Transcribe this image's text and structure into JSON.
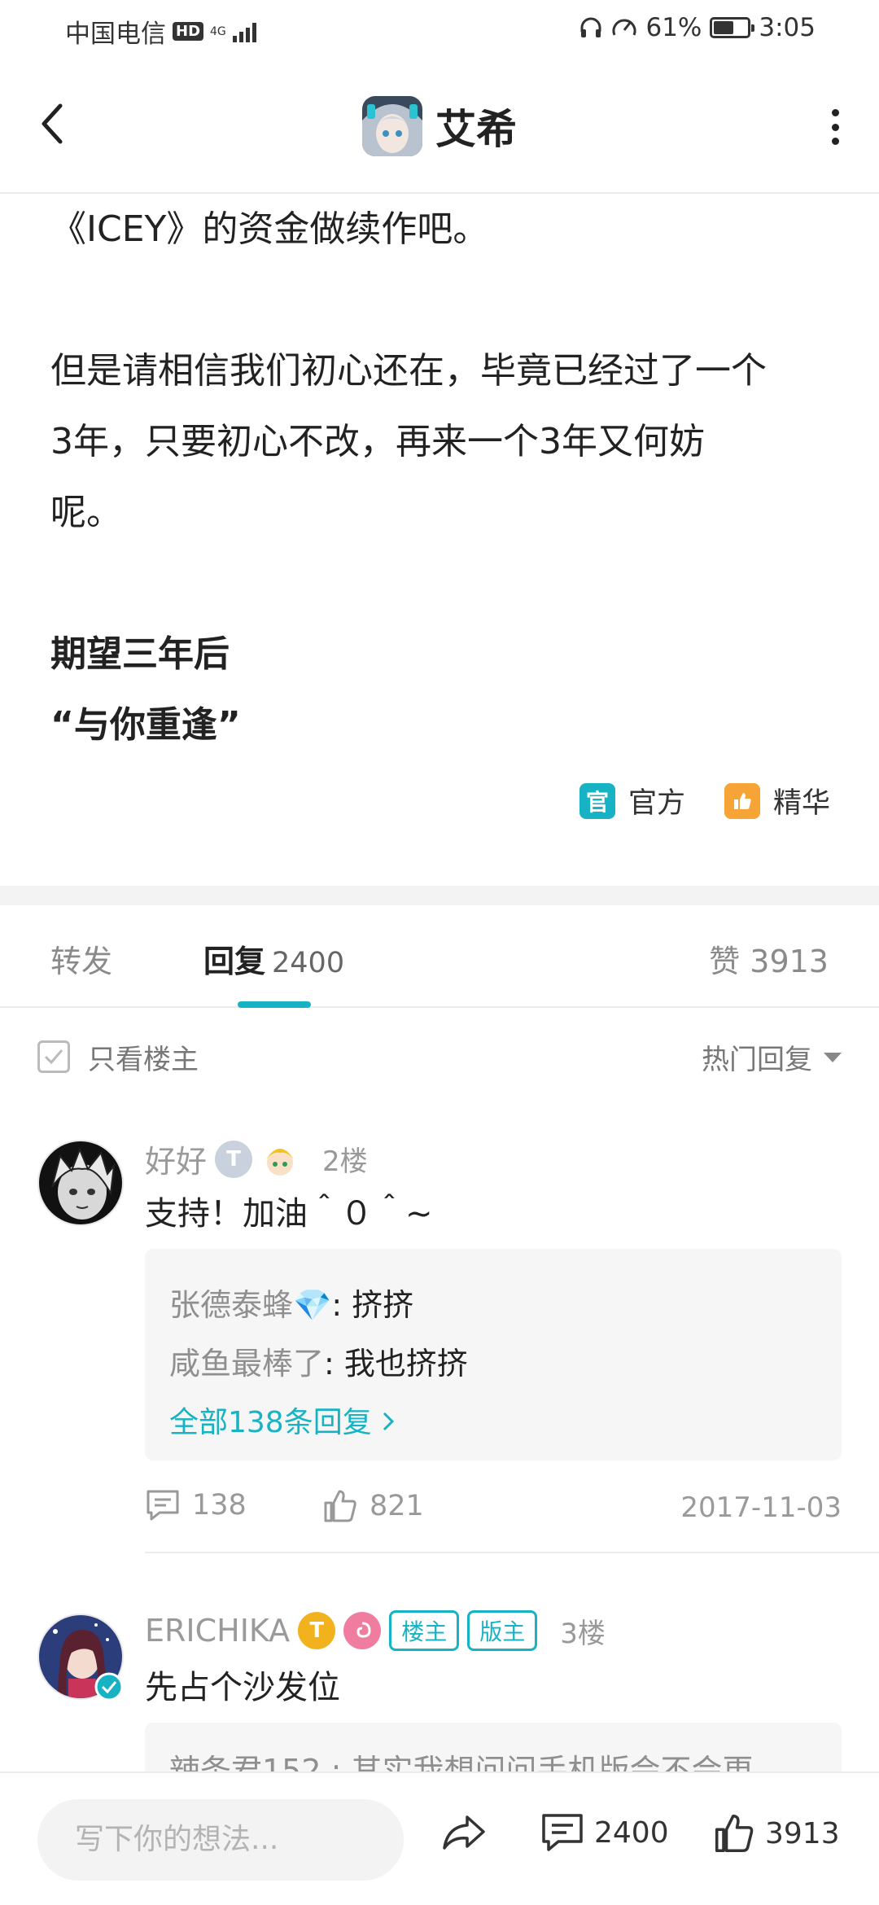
{
  "status_bar": {
    "carrier": "中国电信",
    "hd": "HD",
    "network": "4G",
    "battery_percent": "61%",
    "battery_level": 0.61,
    "time": "3:05"
  },
  "header": {
    "title": "艾希"
  },
  "article": {
    "lines": [
      "《ICEY》的资金做续作吧。",
      "",
      "但是请相信我们初心还在，毕竟已经过了一个",
      "3年，只要初心不改，再来一个3年又何妨",
      "呢。",
      "",
      "期望三年后",
      "“与你重逢”"
    ],
    "tag_official": "官方",
    "tag_official_icon": "官",
    "tag_featured": "精华"
  },
  "tabs": {
    "repost": "转发",
    "reply": "回复",
    "reply_count": "2400",
    "like_label": "赞",
    "like_count": "3913"
  },
  "filter": {
    "only_op": "只看楼主",
    "sort": "热门回复"
  },
  "comments": [
    {
      "username": "好好",
      "level": "T",
      "floor": "2楼",
      "body": "支持！加油＾０＾~",
      "replies": [
        {
          "name": "张德泰蜂💎",
          "text": ": 挤挤"
        },
        {
          "name": "咸鱼最棒了",
          "text": ": 我也挤挤"
        }
      ],
      "more_replies": "全部138条回复",
      "reply_count": "138",
      "like_count": "821",
      "date": "2017-11-03"
    },
    {
      "username": "ERICHIKA",
      "level": "T",
      "role_op": "楼主",
      "role_mod": "版主",
      "floor": "3楼",
      "body": "先占个沙发位",
      "partial_reply": "辣条君152 : 其实我想问问手机版会不会更"
    }
  ],
  "bottom_bar": {
    "placeholder": "写下你的想法...",
    "comment_count": "2400",
    "like_count": "3913"
  },
  "colors": {
    "accent": "#17b3c4",
    "featured": "#f7a436"
  }
}
